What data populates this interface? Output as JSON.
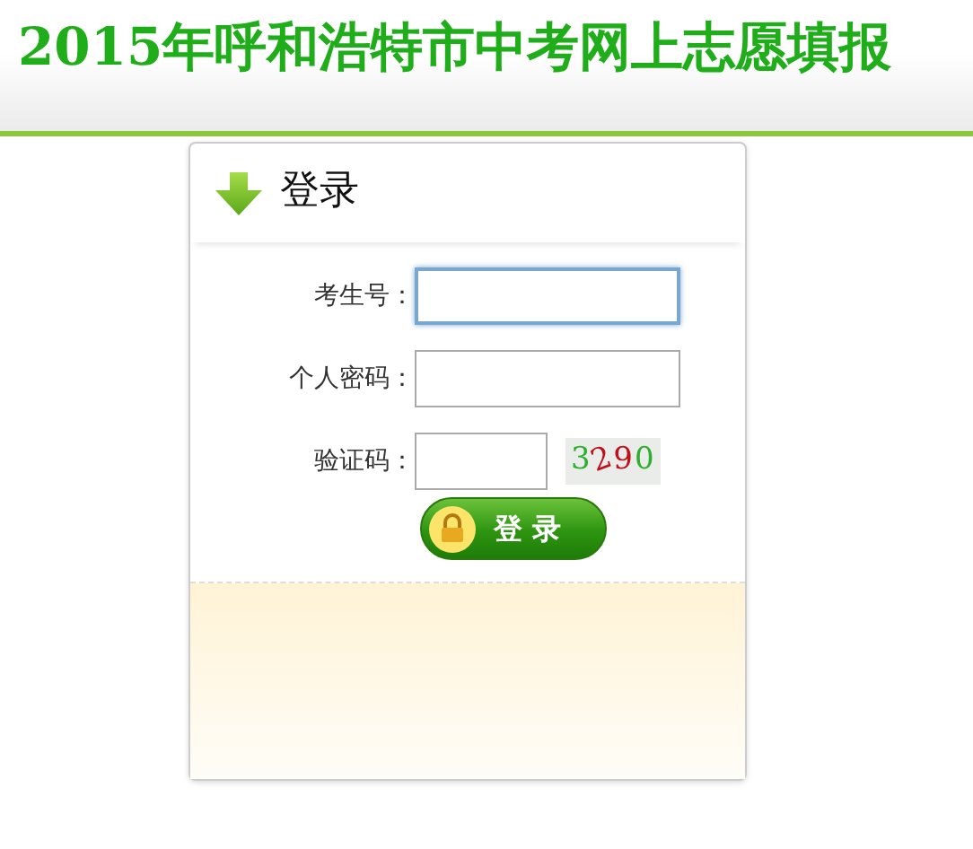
{
  "page_title": "2015年呼和浩特市中考网上志愿填报",
  "login_panel": {
    "heading": "登录",
    "fields": [
      {
        "label": "考生号：",
        "kind": "text",
        "focused": true
      },
      {
        "label": "个人密码：",
        "kind": "password",
        "focused": false
      },
      {
        "label": "验证码：",
        "kind": "captcha",
        "focused": false,
        "captcha": "3290"
      }
    ],
    "button": "登 录"
  }
}
